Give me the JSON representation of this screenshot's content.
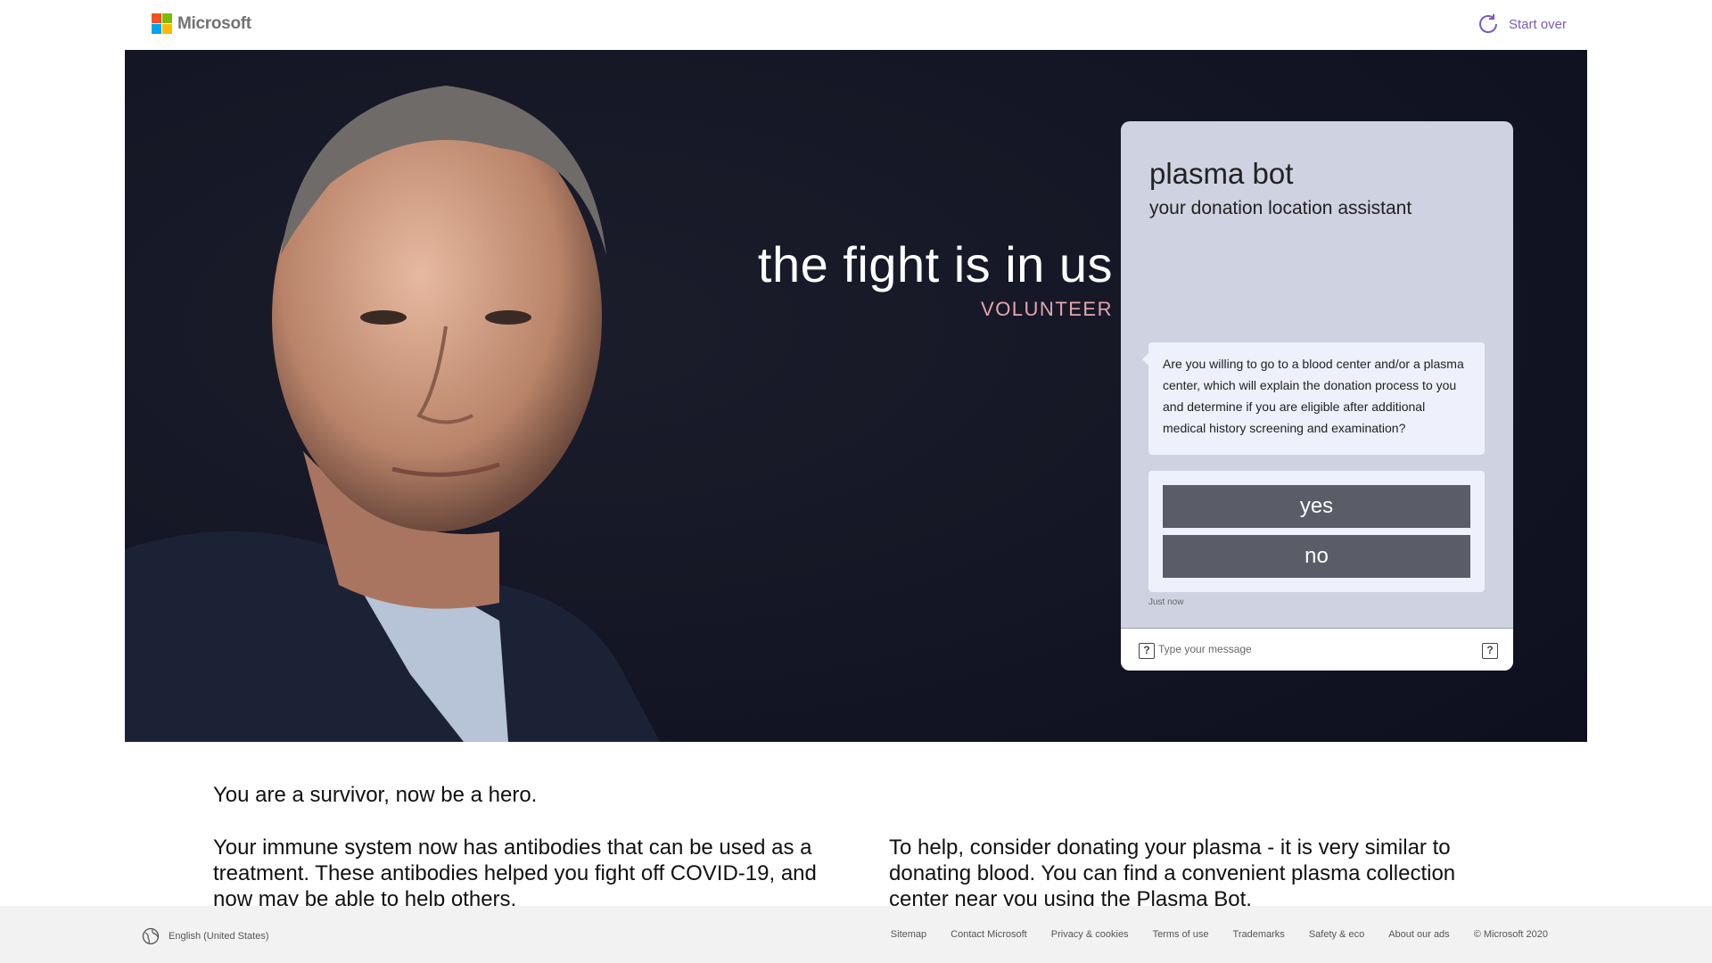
{
  "header": {
    "brand": "Microsoft",
    "start_over_label": "Start over",
    "logo_colors": [
      "#f25022",
      "#7fba00",
      "#00a4ef",
      "#ffb900"
    ]
  },
  "hero": {
    "title": "the fight is in us",
    "subtitle": "VOLUNTEER",
    "background_color": "#121422"
  },
  "bot": {
    "title": "plasma bot",
    "subtitle": "your donation location assistant",
    "message": "Are you willing to go to a blood center and/or a plasma center, which will explain the donation process to you and determine if you are eligible after additional medical history screening and examination?",
    "buttons": [
      "yes",
      "no"
    ],
    "timestamp": "Just now",
    "input_placeholder": "Type your message",
    "card_color": "#cfd2e0"
  },
  "content": {
    "intro": "You are a survivor, now be a hero.",
    "left_paragraph": "Your immune system now has antibodies that can be used as a treatment. These antibodies helped you fight off COVID-19, and now may be able to help others.",
    "right_paragraph": "To help, consider donating your plasma - it is very similar to donating blood. You can find a convenient plasma collection center near you using the Plasma Bot."
  },
  "footer": {
    "locale": "English (United States)",
    "links": [
      "Sitemap",
      "Contact Microsoft",
      "Privacy & cookies",
      "Terms of use",
      "Trademarks",
      "Safety & eco",
      "About our ads",
      "© Microsoft 2020"
    ]
  }
}
